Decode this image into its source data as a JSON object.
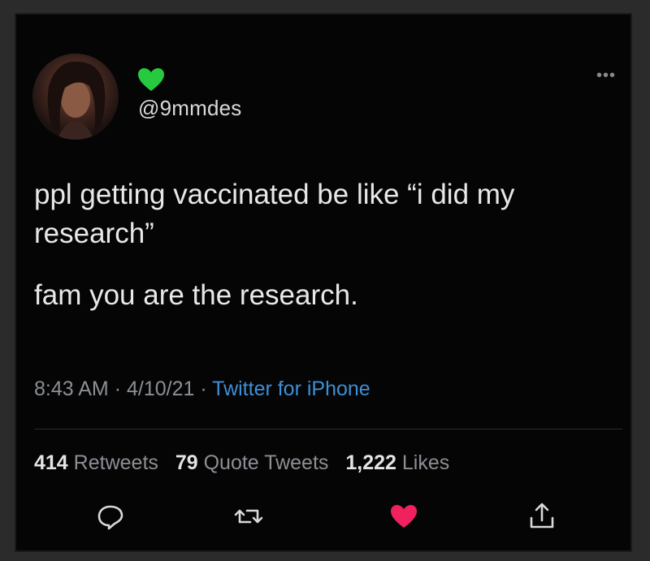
{
  "user": {
    "handle": "@9mmdes",
    "badge_icon": "green-heart-icon",
    "badge_color": "#27c93f"
  },
  "menu": {
    "more_label": "•••"
  },
  "tweet": {
    "paragraphs": [
      "ppl getting vaccinated be like “i did my research”",
      "fam you are the research."
    ]
  },
  "meta": {
    "time": "8:43 AM",
    "date": "4/10/21",
    "separator": "·",
    "source": "Twitter for iPhone"
  },
  "stats": {
    "retweets_count": "414",
    "retweets_label": "Retweets",
    "quotes_count": "79",
    "quotes_label": "Quote Tweets",
    "likes_count": "1,222",
    "likes_label": "Likes"
  },
  "actions": [
    {
      "name": "reply-icon"
    },
    {
      "name": "retweet-icon"
    },
    {
      "name": "like-icon",
      "color": "#f0215f"
    },
    {
      "name": "share-icon"
    }
  ],
  "colors": {
    "background": "#050505",
    "text": "#e8e8e8",
    "muted": "#8b8f94",
    "link": "#3d8fd6"
  }
}
